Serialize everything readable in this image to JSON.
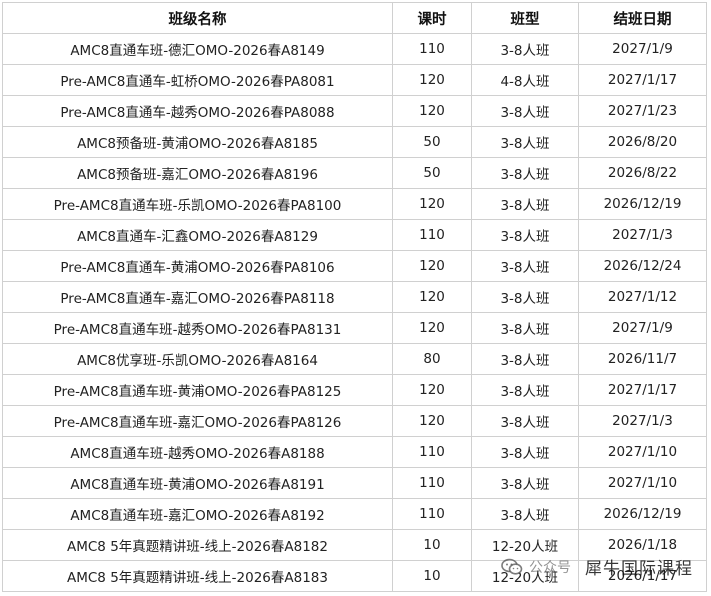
{
  "table": {
    "headers": [
      "班级名称",
      "课时",
      "班型",
      "结班日期"
    ],
    "rows": [
      [
        "AMC8直通车班-德汇OMO-2026春A8149",
        "110",
        "3-8人班",
        "2027/1/9"
      ],
      [
        "Pre-AMC8直通车-虹桥OMO-2026春PA8081",
        "120",
        "4-8人班",
        "2027/1/17"
      ],
      [
        "Pre-AMC8直通车-越秀OMO-2026春PA8088",
        "120",
        "3-8人班",
        "2027/1/23"
      ],
      [
        "AMC8预备班-黄浦OMO-2026春A8185",
        "50",
        "3-8人班",
        "2026/8/20"
      ],
      [
        "AMC8预备班-嘉汇OMO-2026春A8196",
        "50",
        "3-8人班",
        "2026/8/22"
      ],
      [
        "Pre-AMC8直通车班-乐凯OMO-2026春PA8100",
        "120",
        "3-8人班",
        "2026/12/19"
      ],
      [
        "AMC8直通车-汇鑫OMO-2026春A8129",
        "110",
        "3-8人班",
        "2027/1/3"
      ],
      [
        "Pre-AMC8直通车-黄浦OMO-2026春PA8106",
        "120",
        "3-8人班",
        "2026/12/24"
      ],
      [
        "Pre-AMC8直通车-嘉汇OMO-2026春PA8118",
        "120",
        "3-8人班",
        "2027/1/12"
      ],
      [
        "Pre-AMC8直通车班-越秀OMO-2026春PA8131",
        "120",
        "3-8人班",
        "2027/1/9"
      ],
      [
        "AMC8优享班-乐凯OMO-2026春A8164",
        "80",
        "3-8人班",
        "2026/11/7"
      ],
      [
        "Pre-AMC8直通车班-黄浦OMO-2026春PA8125",
        "120",
        "3-8人班",
        "2027/1/17"
      ],
      [
        "Pre-AMC8直通车班-嘉汇OMO-2026春PA8126",
        "120",
        "3-8人班",
        "2027/1/3"
      ],
      [
        "AMC8直通车班-越秀OMO-2026春A8188",
        "110",
        "3-8人班",
        "2027/1/10"
      ],
      [
        "AMC8直通车班-黄浦OMO-2026春A8191",
        "110",
        "3-8人班",
        "2027/1/10"
      ],
      [
        "AMC8直通车班-嘉汇OMO-2026春A8192",
        "110",
        "3-8人班",
        "2026/12/19"
      ],
      [
        "AMC8 5年真题精讲班-线上-2026春A8182",
        "10",
        "12-20人班",
        "2026/1/18"
      ],
      [
        "AMC8 5年真题精讲班-线上-2026春A8183",
        "10",
        "12-20人班",
        "2026/1/17"
      ]
    ]
  },
  "watermark": {
    "icon": "wechat-icon",
    "source": "公众号",
    "brand": "犀牛国际课程"
  }
}
